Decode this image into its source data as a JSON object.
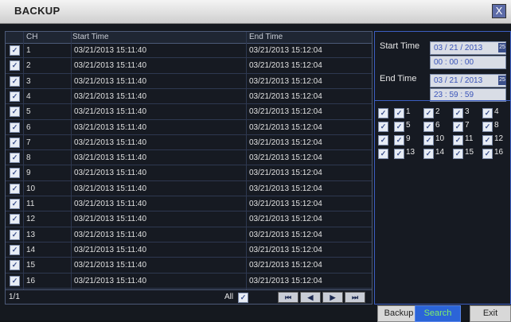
{
  "window": {
    "title": "BACKUP",
    "close_label": "X"
  },
  "table": {
    "headers": {
      "ch": "CH",
      "start": "Start Time",
      "end": "End Time"
    },
    "rows": [
      {
        "ch": "1",
        "start": "03/21/2013 15:11:40",
        "end": "03/21/2013 15:12:04"
      },
      {
        "ch": "2",
        "start": "03/21/2013 15:11:40",
        "end": "03/21/2013 15:12:04"
      },
      {
        "ch": "3",
        "start": "03/21/2013 15:11:40",
        "end": "03/21/2013 15:12:04"
      },
      {
        "ch": "4",
        "start": "03/21/2013 15:11:40",
        "end": "03/21/2013 15:12:04"
      },
      {
        "ch": "5",
        "start": "03/21/2013 15:11:40",
        "end": "03/21/2013 15:12:04"
      },
      {
        "ch": "6",
        "start": "03/21/2013 15:11:40",
        "end": "03/21/2013 15:12:04"
      },
      {
        "ch": "7",
        "start": "03/21/2013 15:11:40",
        "end": "03/21/2013 15:12:04"
      },
      {
        "ch": "8",
        "start": "03/21/2013 15:11:40",
        "end": "03/21/2013 15:12:04"
      },
      {
        "ch": "9",
        "start": "03/21/2013 15:11:40",
        "end": "03/21/2013 15:12:04"
      },
      {
        "ch": "10",
        "start": "03/21/2013 15:11:40",
        "end": "03/21/2013 15:12:04"
      },
      {
        "ch": "11",
        "start": "03/21/2013 15:11:40",
        "end": "03/21/2013 15:12:04"
      },
      {
        "ch": "12",
        "start": "03/21/2013 15:11:40",
        "end": "03/21/2013 15:12:04"
      },
      {
        "ch": "13",
        "start": "03/21/2013 15:11:40",
        "end": "03/21/2013 15:12:04"
      },
      {
        "ch": "14",
        "start": "03/21/2013 15:11:40",
        "end": "03/21/2013 15:12:04"
      },
      {
        "ch": "15",
        "start": "03/21/2013 15:11:40",
        "end": "03/21/2013 15:12:04"
      },
      {
        "ch": "16",
        "start": "03/21/2013 15:11:40",
        "end": "03/21/2013 15:12:04"
      }
    ],
    "footer": {
      "page": "1/1",
      "all_label": "All"
    }
  },
  "search_panel": {
    "start_label": "Start Time",
    "start_date": "03 / 21 / 2013",
    "start_time": "00  :  00  :  00",
    "end_label": "End Time",
    "end_date": "03 / 21 / 2013",
    "end_time": "23  :  59  :  59",
    "calendar_icon_label": "25",
    "channels": [
      "1",
      "2",
      "3",
      "4",
      "5",
      "6",
      "7",
      "8",
      "9",
      "10",
      "11",
      "12",
      "13",
      "14",
      "15",
      "16"
    ]
  },
  "buttons": {
    "backup": "Backup",
    "search": "Search",
    "exit": "Exit"
  },
  "colors": {
    "accent": "#2b64d8",
    "search_text": "#7ef06a",
    "panel_border": "#3c5ec2"
  },
  "icons": {
    "check": "✓",
    "first": "⏮",
    "prev": "◀",
    "next": "▶",
    "last": "⏭"
  }
}
